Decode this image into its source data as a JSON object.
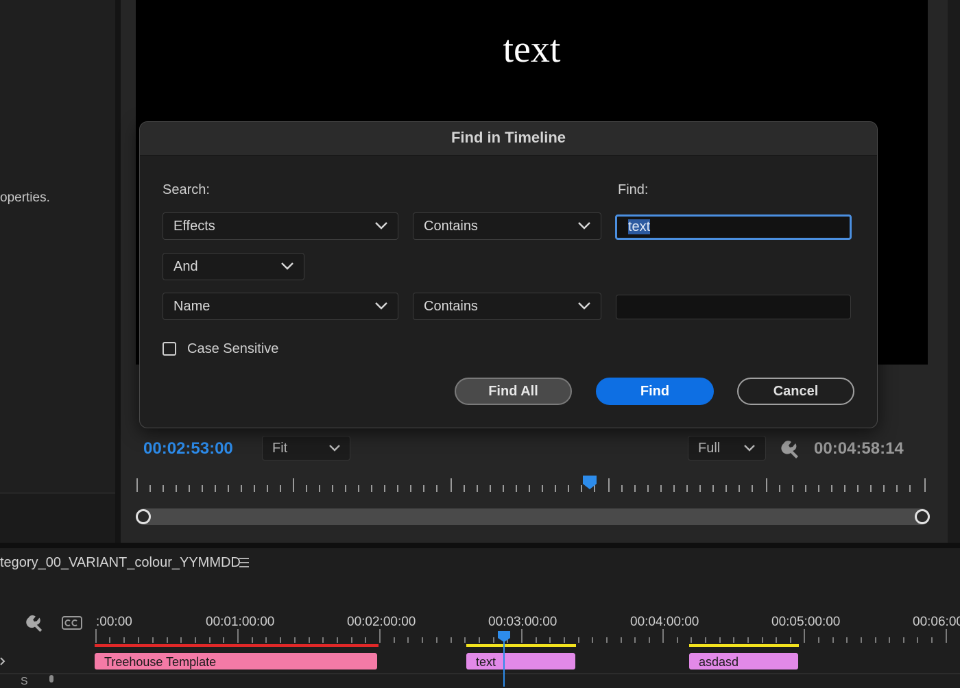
{
  "left_panel": {
    "partial_text": "operties."
  },
  "monitor": {
    "video_text": "text",
    "playhead_timecode": "00:02:53:00",
    "zoom_dropdown": "Fit",
    "resolution_dropdown": "Full",
    "duration_timecode": "00:04:58:14"
  },
  "dialog": {
    "title": "Find in Timeline",
    "search_label": "Search:",
    "find_label": "Find:",
    "row1": {
      "property": "Effects",
      "operator": "Contains",
      "value": "text"
    },
    "logic": "And",
    "row2": {
      "property": "Name",
      "operator": "Contains",
      "value": ""
    },
    "case_sensitive_label": "Case Sensitive",
    "case_sensitive_checked": false,
    "buttons": {
      "find_all": "Find All",
      "find": "Find",
      "cancel": "Cancel"
    }
  },
  "timeline": {
    "sequence_name": "tegory_00_VARIANT_colour_YYMMDD",
    "timecodes": [
      ":00:00",
      "00:01:00:00",
      "00:02:00:00",
      "00:03:00:00",
      "00:04:00:00",
      "00:05:00:00",
      "00:06:00"
    ],
    "clips": [
      {
        "label": "Treehouse Template"
      },
      {
        "label": "text"
      },
      {
        "label": "asdasd"
      }
    ],
    "track_label": "S"
  },
  "colors": {
    "accent": "#2d8ceb",
    "find_button": "#0e6fe3",
    "clip_pink": "#f47aa6",
    "clip_violet": "#e289e8",
    "bar_red": "#e02828",
    "bar_yellow": "#f2e21e"
  },
  "icons": [
    "wrench-icon",
    "closed-captions-icon",
    "hamburger-menu-icon",
    "chevron-down-icon",
    "microphone-icon"
  ]
}
